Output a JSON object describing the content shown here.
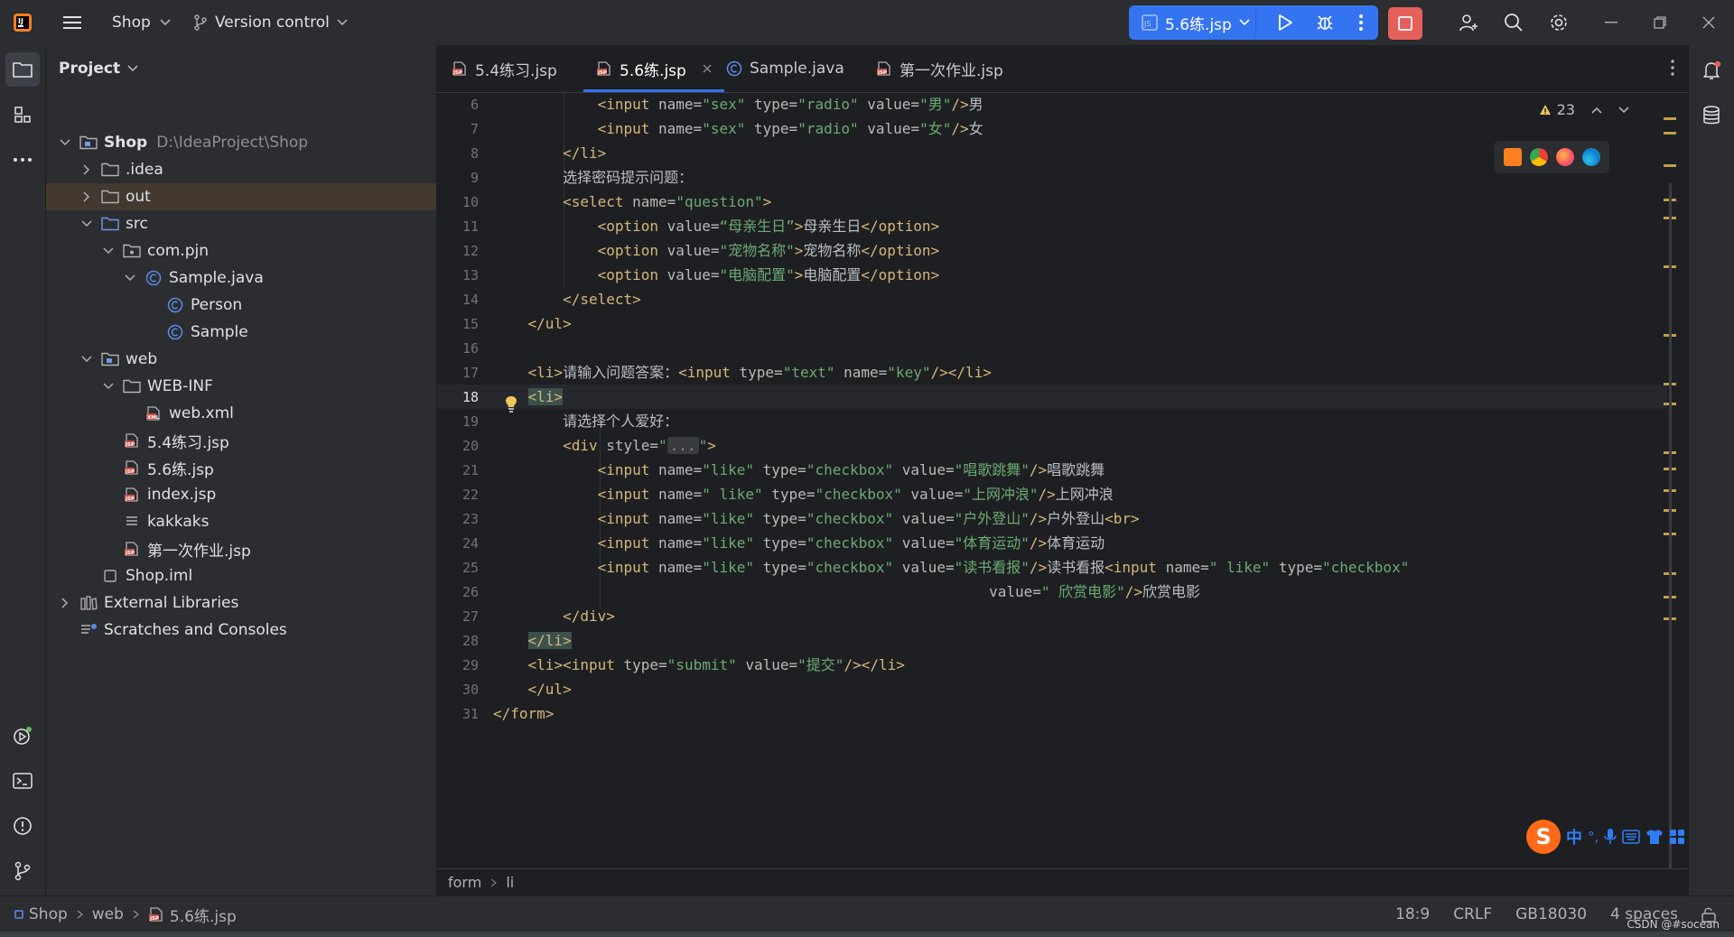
{
  "titlebar": {
    "project_name": "Shop",
    "vcs_label": "Version control",
    "run_config": "5.6练.jsp"
  },
  "project_panel": {
    "title": "Project",
    "tree": [
      {
        "label": "Shop",
        "path": "D:\\IdeaProject\\Shop",
        "icon": "module-folder-icon",
        "bold": true
      },
      {
        "label": ".idea",
        "icon": "folder-icon"
      },
      {
        "label": "out",
        "icon": "folder-icon",
        "selected": true
      },
      {
        "label": "src",
        "icon": "source-folder-icon"
      },
      {
        "label": "com.pjn",
        "icon": "package-icon"
      },
      {
        "label": "Sample.java",
        "icon": "java-class-icon"
      },
      {
        "label": "Person",
        "icon": "java-class-icon"
      },
      {
        "label": "Sample",
        "icon": "java-class-icon"
      },
      {
        "label": "web",
        "icon": "web-folder-icon"
      },
      {
        "label": "WEB-INF",
        "icon": "folder-icon"
      },
      {
        "label": "web.xml",
        "icon": "xml-file-icon"
      },
      {
        "label": "5.4练习.jsp",
        "icon": "jsp-file-icon"
      },
      {
        "label": "5.6练.jsp",
        "icon": "jsp-file-icon"
      },
      {
        "label": "index.jsp",
        "icon": "jsp-file-icon"
      },
      {
        "label": "kakkaks",
        "icon": "text-file-icon"
      },
      {
        "label": "第一次作业.jsp",
        "icon": "jsp-file-icon"
      },
      {
        "label": "Shop.iml",
        "icon": "iml-file-icon"
      },
      {
        "label": "External Libraries",
        "icon": "libraries-icon"
      },
      {
        "label": "Scratches and Consoles",
        "icon": "scratches-icon"
      }
    ]
  },
  "editor": {
    "tabs": [
      {
        "label": "5.4练习.jsp",
        "icon": "jsp-file-icon"
      },
      {
        "label": "5.6练.jsp",
        "icon": "jsp-file-icon",
        "active": true
      },
      {
        "label": "Sample.java",
        "icon": "java-class-icon"
      },
      {
        "label": "第一次作业.jsp",
        "icon": "jsp-file-icon"
      }
    ],
    "inspection_count": "23",
    "current_line": "18",
    "lines": [
      {
        "n": "6",
        "html": "            <span class='t'>&lt;input</span> <span class='a'>name=</span><span class='s'>\"sex\"</span> <span class='a'>type=</span><span class='s'>\"radio\"</span> <span class='a'>value=</span><span class='s'>\"男\"</span><span class='t'>/&gt;</span>男"
      },
      {
        "n": "7",
        "html": "            <span class='t'>&lt;input</span> <span class='a'>name=</span><span class='s'>\"sex\"</span> <span class='a'>type=</span><span class='s'>\"radio\"</span> <span class='a'>value=</span><span class='s'>\"女\"</span><span class='t'>/&gt;</span>女"
      },
      {
        "n": "8",
        "html": "        <span class='t'>&lt;/li&gt;</span>"
      },
      {
        "n": "9",
        "html": "        选择密码提示问题："
      },
      {
        "n": "10",
        "html": "        <span class='t'>&lt;select</span> <span class='a'>name=</span><span class='s'>\"question\"</span><span class='t'>&gt;</span>"
      },
      {
        "n": "11",
        "html": "            <span class='t'>&lt;option</span> <span class='a'>value=</span><span class='s'>“母亲生日”</span><span class='t'>&gt;</span>母亲生日<span class='t'>&lt;/option&gt;</span>"
      },
      {
        "n": "12",
        "html": "            <span class='t'>&lt;option</span> <span class='a'>value=</span><span class='s'>\"宠物名称\"</span><span class='t'>&gt;</span>宠物名称<span class='t'>&lt;/option&gt;</span>"
      },
      {
        "n": "13",
        "html": "            <span class='t'>&lt;option</span> <span class='a'>value=</span><span class='s'>\"电脑配置\"</span><span class='t'>&gt;</span>电脑配置<span class='t'>&lt;/option&gt;</span>"
      },
      {
        "n": "14",
        "html": "        <span class='t'>&lt;/select&gt;</span>"
      },
      {
        "n": "15",
        "html": "    <span class='t'>&lt;/ul&gt;</span>"
      },
      {
        "n": "16",
        "html": ""
      },
      {
        "n": "17",
        "html": "    <span class='t'>&lt;li&gt;</span>请输入问题答案：<span class='t'>&lt;input</span> <span class='a'>type=</span><span class='s'>\"text\"</span> <span class='a'>name=</span><span class='s'>\"key\"</span><span class='t'>/&gt;&lt;/li&gt;</span>"
      },
      {
        "n": "18",
        "html": "    <span class='t hl'>&lt;li&gt;</span>"
      },
      {
        "n": "19",
        "html": "        请选择个人爱好："
      },
      {
        "n": "20",
        "html": "        <span class='t'>&lt;div</span> <span class='a'>style=</span><span class='s'>\"<span class='fold'>...</span>\"</span><span class='t'>&gt;</span>"
      },
      {
        "n": "21",
        "html": "            <span class='t'>&lt;input</span> <span class='a'>name=</span><span class='s'>\"like\"</span> <span class='a'>type=</span><span class='s'>\"checkbox\"</span> <span class='a'>value=</span><span class='s'>\"唱歌跳舞\"</span><span class='t'>/&gt;</span>唱歌跳舞"
      },
      {
        "n": "22",
        "html": "            <span class='t'>&lt;input</span> <span class='a'>name=</span><span class='s'>\" like\"</span> <span class='a'>type=</span><span class='s'>\"checkbox\"</span> <span class='a'>value=</span><span class='s'>\"上网冲浪\"</span><span class='t'>/&gt;</span>上网冲浪"
      },
      {
        "n": "23",
        "html": "            <span class='t'>&lt;input</span> <span class='a'>name=</span><span class='s'>\"like\"</span> <span class='a'>type=</span><span class='s'>\"checkbox\"</span> <span class='a'>value=</span><span class='s'>\"户外登山\"</span><span class='t'>/&gt;</span>户外登山<span class='t'>&lt;br&gt;</span>"
      },
      {
        "n": "24",
        "html": "            <span class='t'>&lt;input</span> <span class='a'>name=</span><span class='s'>\"like\"</span> <span class='a'>type=</span><span class='s'>\"checkbox\"</span> <span class='a'>value=</span><span class='s'>\"体育运动\"</span><span class='t'>/&gt;</span>体育运动"
      },
      {
        "n": "25",
        "html": "            <span class='t'>&lt;input</span> <span class='a'>name=</span><span class='s'>\"like\"</span> <span class='a'>type=</span><span class='s'>\"checkbox\"</span> <span class='a'>value=</span><span class='s'>\"读书看报\"</span><span class='t'>/&gt;</span>读书看报<span class='t'>&lt;input</span> <span class='a'>name=</span><span class='s'>\" like\"</span> <span class='a'>type=</span><span class='s'>\"checkbox\"</span>"
      },
      {
        "n": "26",
        "html": "                                                         <span class='a'>value=</span><span class='s'>\" 欣赏电影\"</span><span class='t'>/&gt;</span>欣赏电影"
      },
      {
        "n": "27",
        "html": "        <span class='t'>&lt;/div&gt;</span>"
      },
      {
        "n": "28",
        "html": "    <span class='t hl'>&lt;/li&gt;</span>"
      },
      {
        "n": "29",
        "html": "    <span class='t'>&lt;li&gt;&lt;input</span> <span class='a'>type=</span><span class='s'>\"submit\"</span> <span class='a'>value=</span><span class='s'>\"提交\"</span><span class='t'>/&gt;&lt;/li&gt;</span>"
      },
      {
        "n": "30",
        "html": "    <span class='t'>&lt;/ul&gt;</span>"
      },
      {
        "n": "31",
        "html": "<span class='t'>&lt;/form&gt;</span>"
      }
    ],
    "breadcrumb": [
      "form",
      "li"
    ]
  },
  "statusbar": {
    "crumbs": [
      "Shop",
      "web",
      "5.6练.jsp"
    ],
    "position": "18:9",
    "line_sep": "CRLF",
    "encoding": "GB18030",
    "indent": "4 spaces"
  },
  "ime": {
    "lang": "中",
    "punct": "°,"
  },
  "watermark": "CSDN @#socean",
  "colors": {
    "accent": "#3574f0",
    "stop": "#e5605a",
    "tag": "#d5b778",
    "string": "#6aab73",
    "selected_row": "#43392e"
  }
}
